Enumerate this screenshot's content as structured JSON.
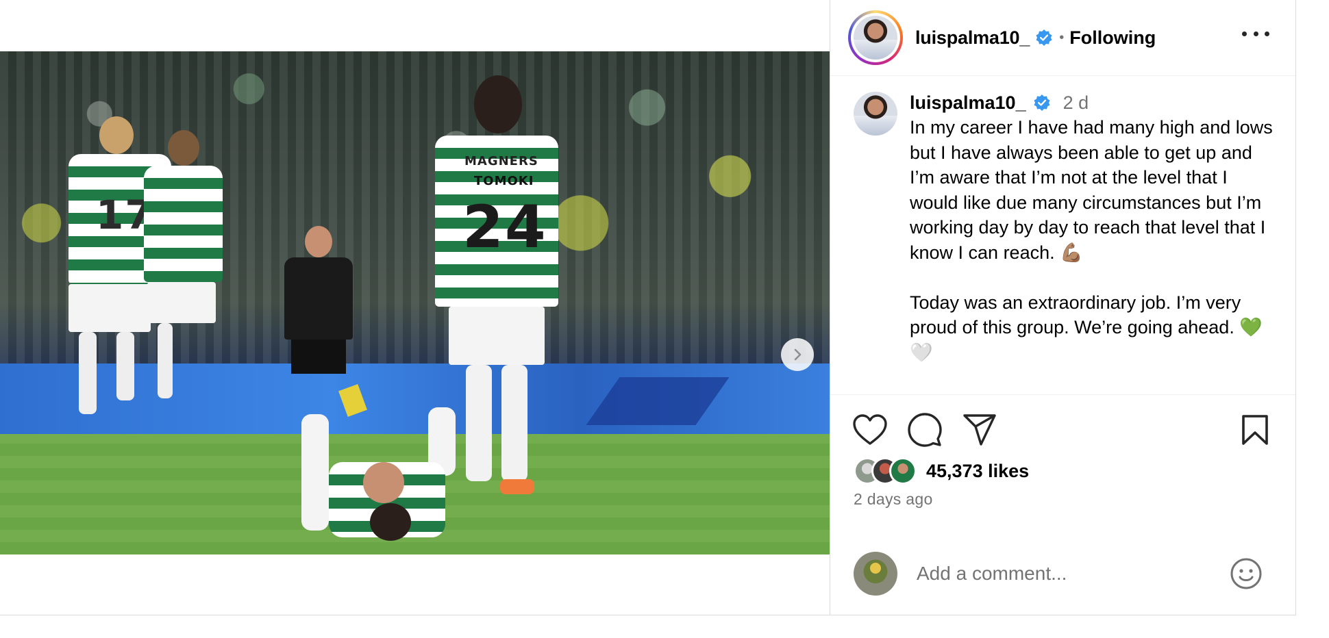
{
  "post": {
    "username": "luispalma10_",
    "follow_status": "Following",
    "caption_username": "luispalma10_",
    "caption_time": "2 d",
    "caption_text": "In my career I have had many high and lows but I have always been able to get up and I’m aware that I’m not at the level that I would like due many circumstances but I’m working day by day to reach that level that I know I can reach. 💪🏽\n\nToday was an extraordinary job. I’m very proud of this group. We’re going ahead. 💚🤍",
    "likes": "45,373 likes",
    "posted_ago": "2 days ago",
    "comment_placeholder": "Add a comment..."
  },
  "media": {
    "jersey_names": [
      "MAGNERS",
      "TOMOKI"
    ],
    "jersey_numbers": [
      "24",
      "17"
    ],
    "carousel": {
      "slide_count": 4,
      "active_index": 1
    }
  },
  "colors": {
    "verified": "#3897f0",
    "celtic_green": "#1f7a45",
    "muted_text": "#737373"
  },
  "icons": {
    "like": "heart-icon",
    "comment": "comment-icon",
    "share": "paper-plane-icon",
    "save": "bookmark-icon",
    "more": "more-options-icon",
    "next": "chevron-right-icon",
    "emoji": "smiley-icon"
  }
}
